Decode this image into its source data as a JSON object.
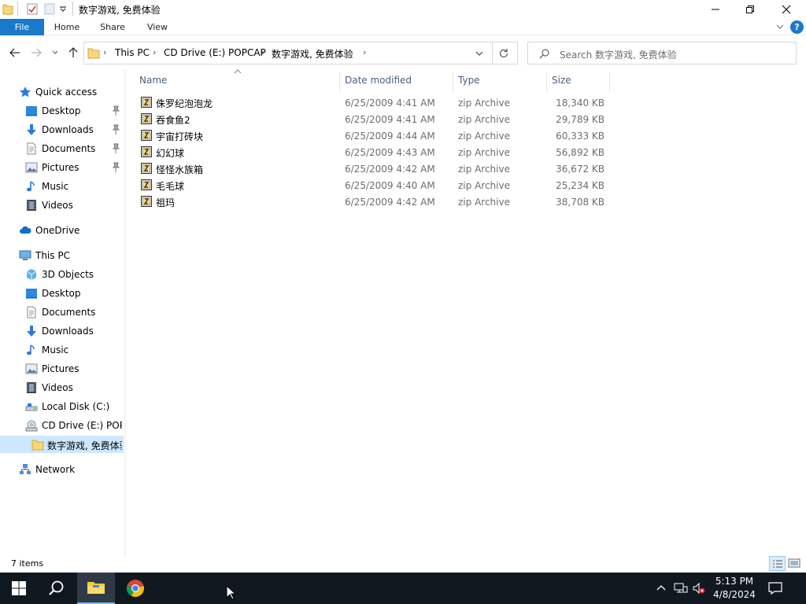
{
  "window": {
    "title": "数字游戏, 免费体验"
  },
  "ribbon": {
    "tabs": [
      "File",
      "Home",
      "Share",
      "View"
    ],
    "help_label": "?"
  },
  "address": {
    "crumbs": [
      "This PC",
      "CD Drive (E:) POPCAP",
      "数字游戏, 免费体验"
    ],
    "search_placeholder": "Search 数字游戏, 免费体验"
  },
  "nav": {
    "quick_access": "Quick access",
    "quick_items": [
      "Desktop",
      "Downloads",
      "Documents",
      "Pictures",
      "Music",
      "Videos"
    ],
    "onedrive": "OneDrive",
    "this_pc": "This PC",
    "pc_items": [
      "3D Objects",
      "Desktop",
      "Documents",
      "Downloads",
      "Music",
      "Pictures",
      "Videos",
      "Local Disk (C:)",
      "CD Drive (E:) POPCAP"
    ],
    "selected_folder": "数字游戏, 免费体验",
    "network": "Network"
  },
  "columns": {
    "name": "Name",
    "date": "Date modified",
    "type": "Type",
    "size": "Size"
  },
  "files": [
    {
      "name": "侏罗纪泡泡龙",
      "date": "6/25/2009 4:41 AM",
      "type": "zip Archive",
      "size": "18,340 KB"
    },
    {
      "name": "吞食鱼2",
      "date": "6/25/2009 4:41 AM",
      "type": "zip Archive",
      "size": "29,789 KB"
    },
    {
      "name": "宇宙打砖块",
      "date": "6/25/2009 4:44 AM",
      "type": "zip Archive",
      "size": "60,333 KB"
    },
    {
      "name": "幻幻球",
      "date": "6/25/2009 4:43 AM",
      "type": "zip Archive",
      "size": "56,892 KB"
    },
    {
      "name": "怪怪水族箱",
      "date": "6/25/2009 4:42 AM",
      "type": "zip Archive",
      "size": "36,672 KB"
    },
    {
      "name": "毛毛球",
      "date": "6/25/2009 4:40 AM",
      "type": "zip Archive",
      "size": "25,234 KB"
    },
    {
      "name": "祖玛",
      "date": "6/25/2009 4:42 AM",
      "type": "zip Archive",
      "size": "38,708 KB"
    }
  ],
  "status": {
    "item_count": "7 items"
  },
  "taskbar": {
    "time": "5:13 PM",
    "date": "4/8/2024"
  },
  "colors": {
    "file_tab": "#1979ca",
    "selection": "#cce8ff",
    "taskbar": "#101820",
    "folder": "#f8d775"
  }
}
